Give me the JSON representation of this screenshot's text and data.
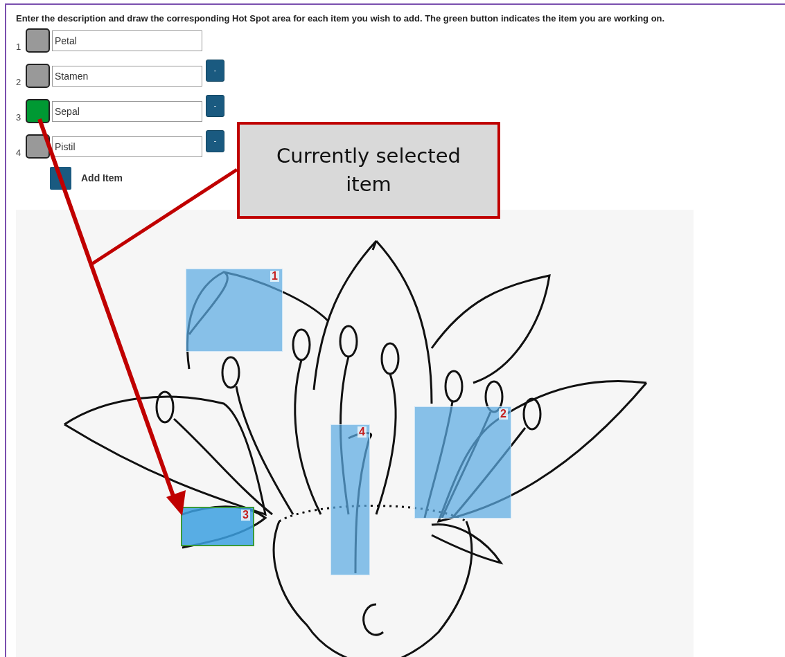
{
  "instruction": "Enter the description and draw the corresponding Hot Spot area for each item you wish to add. The green button indicates the item you are working on.",
  "items": [
    {
      "number": "1",
      "value": "Petal",
      "selected": false,
      "removable": false
    },
    {
      "number": "2",
      "value": "Stamen",
      "selected": false,
      "removable": true,
      "remove_label": "-"
    },
    {
      "number": "3",
      "value": "Sepal",
      "selected": true,
      "removable": true,
      "remove_label": "-"
    },
    {
      "number": "4",
      "value": "Pistil",
      "selected": false,
      "removable": true,
      "remove_label": "-"
    }
  ],
  "add_item": {
    "label": "Add Item"
  },
  "hotspots": [
    {
      "label": "1",
      "selected": false
    },
    {
      "label": "2",
      "selected": false
    },
    {
      "label": "3",
      "selected": true
    },
    {
      "label": "4",
      "selected": false
    }
  ],
  "callout": {
    "text": "Currently selected item"
  }
}
